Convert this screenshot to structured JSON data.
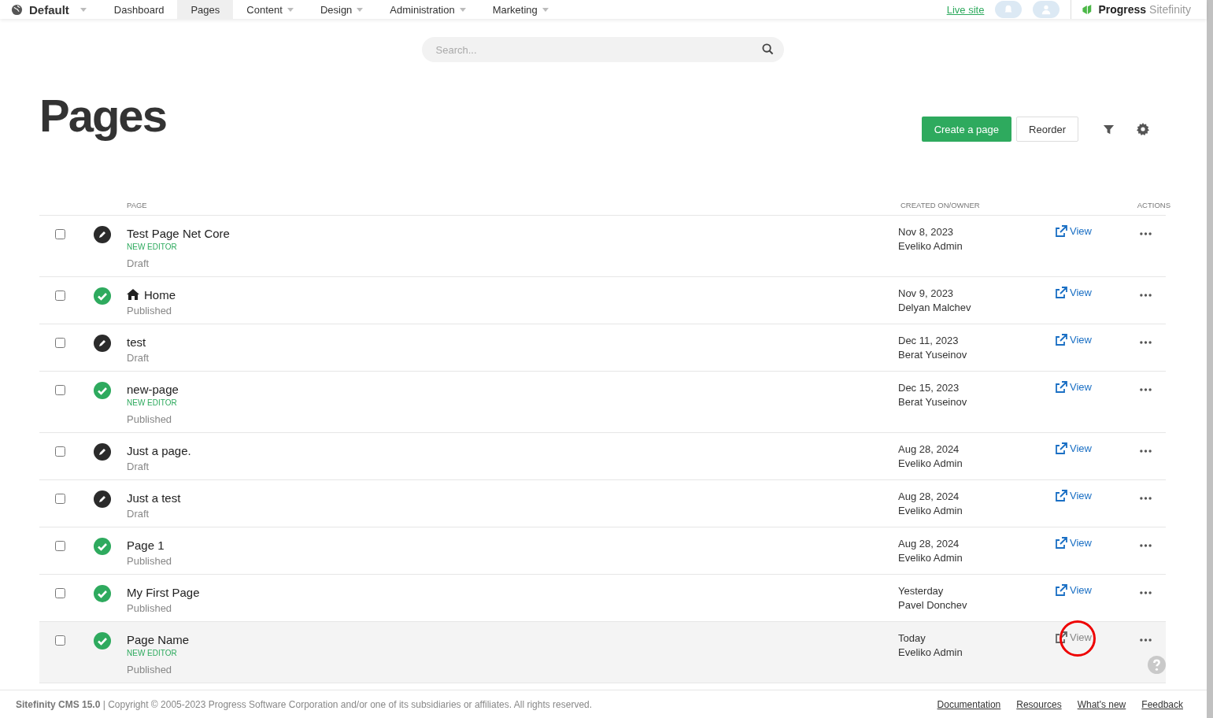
{
  "nav": {
    "site": {
      "label": "Default",
      "has_menu": true
    },
    "items": [
      {
        "label": "Dashboard",
        "has_menu": false,
        "selected": false
      },
      {
        "label": "Pages",
        "has_menu": false,
        "selected": true
      },
      {
        "label": "Content",
        "has_menu": true,
        "selected": false
      },
      {
        "label": "Design",
        "has_menu": true,
        "selected": false
      },
      {
        "label": "Administration",
        "has_menu": true,
        "selected": false
      },
      {
        "label": "Marketing",
        "has_menu": true,
        "selected": false
      }
    ],
    "live_site": "Live site",
    "brand": {
      "name": "Progress",
      "product": "Sitefinity"
    }
  },
  "search": {
    "placeholder": "Search..."
  },
  "title": "Pages",
  "toolbar": {
    "create": "Create a page",
    "reorder": "Reorder"
  },
  "table": {
    "columns": {
      "page": "PAGE",
      "created": "CREATED ON/OWNER",
      "actions": "ACTIONS"
    },
    "rows": [
      {
        "checked": false,
        "kind": "draft",
        "home": false,
        "title": "Test Page Net Core",
        "tag": "NEW EDITOR",
        "status": "Draft",
        "date": "Nov 8, 2023",
        "owner": "Eveliko Admin",
        "view": "View",
        "hovered": false,
        "circled": false
      },
      {
        "checked": false,
        "kind": "published",
        "home": true,
        "title": "Home",
        "status": "Published",
        "date": "Nov 9, 2023",
        "owner": "Delyan Malchev",
        "view": "View",
        "hovered": false,
        "circled": false
      },
      {
        "checked": false,
        "kind": "draft",
        "home": false,
        "title": "test",
        "status": "Draft",
        "date": "Dec 11, 2023",
        "owner": "Berat Yuseinov",
        "view": "View",
        "hovered": false,
        "circled": false
      },
      {
        "checked": false,
        "kind": "published",
        "home": false,
        "title": "new-page",
        "tag": "NEW EDITOR",
        "status": "Published",
        "date": "Dec 15, 2023",
        "owner": "Berat Yuseinov",
        "view": "View",
        "hovered": false,
        "circled": false
      },
      {
        "checked": false,
        "kind": "draft",
        "home": false,
        "title": "Just a page.",
        "status": "Draft",
        "date": "Aug 28, 2024",
        "owner": "Eveliko Admin",
        "view": "View",
        "hovered": false,
        "circled": false
      },
      {
        "checked": false,
        "kind": "draft",
        "home": false,
        "title": "Just a test",
        "status": "Draft",
        "date": "Aug 28, 2024",
        "owner": "Eveliko Admin",
        "view": "View",
        "hovered": false,
        "circled": false
      },
      {
        "checked": false,
        "kind": "published",
        "home": false,
        "title": "Page 1",
        "status": "Published",
        "date": "Aug 28, 2024",
        "owner": "Eveliko Admin",
        "view": "View",
        "hovered": false,
        "circled": false
      },
      {
        "checked": false,
        "kind": "published",
        "home": false,
        "title": "My First Page",
        "status": "Published",
        "date": "Yesterday",
        "owner": "Pavel Donchev",
        "view": "View",
        "hovered": false,
        "circled": false
      },
      {
        "checked": false,
        "kind": "published",
        "home": false,
        "title": "Page Name",
        "tag": "NEW EDITOR",
        "status": "Published",
        "date": "Today",
        "owner": "Eveliko Admin",
        "view": "View",
        "hovered": true,
        "circled": true
      }
    ]
  },
  "footer": {
    "product": "Sitefinity CMS 15.0",
    "copyright": "| Copyright © 2005-2023 Progress Software Corporation and/or one of its subsidiaries or affiliates. All rights reserved.",
    "links": [
      "Documentation",
      "Resources",
      "What's new",
      "Feedback"
    ]
  }
}
